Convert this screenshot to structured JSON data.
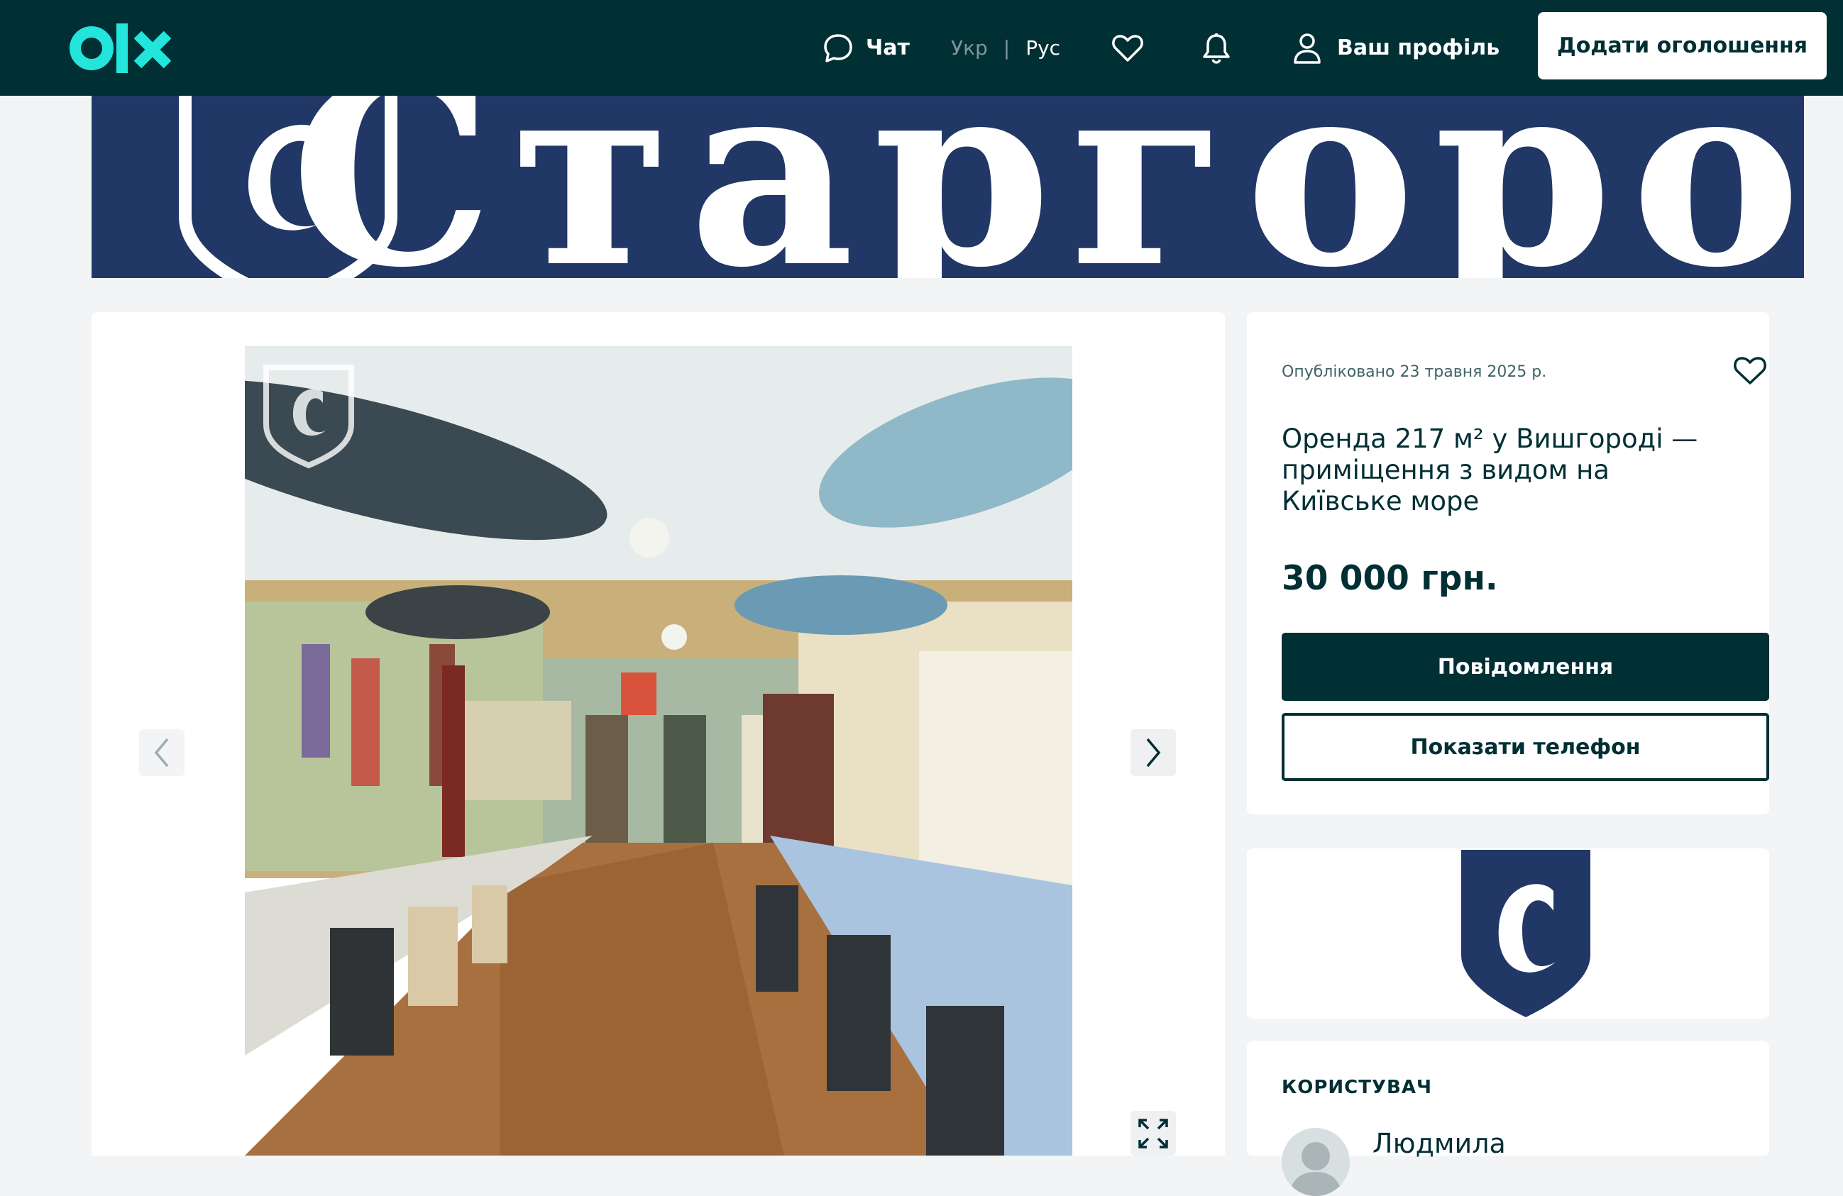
{
  "header": {
    "logo_text": "olx",
    "chat_label": "Чат",
    "lang_ukr": "Укр",
    "lang_separator": "|",
    "lang_rus": "Рус",
    "profile_label": "Ваш профіль",
    "add_listing_label": "Додати оголошення",
    "icons": [
      "chat-icon",
      "heart-icon",
      "bell-icon",
      "user-icon"
    ]
  },
  "banner": {
    "brand_text": "Старгород",
    "color": "#213765"
  },
  "gallery": {
    "prev_icon": "chevron-left-icon",
    "next_icon": "chevron-right-icon",
    "fullscreen_icon": "expand-icon"
  },
  "listing": {
    "published": "Опубліковано 23 травня 2025 р.",
    "title": "Оренда 217 м² у Вишгороді — приміщення з видом на Київське море",
    "price": "30 000 грн.",
    "message_button": "Повідомлення",
    "phone_button": "Показати телефон"
  },
  "seller": {
    "heading": "КОРИСТУВАЧ",
    "name": "Людмила"
  },
  "colors": {
    "brand_dark": "#002f34",
    "logo_accent": "#23e5db",
    "shield_blue": "#213765",
    "page_bg": "#f2f4f5"
  }
}
